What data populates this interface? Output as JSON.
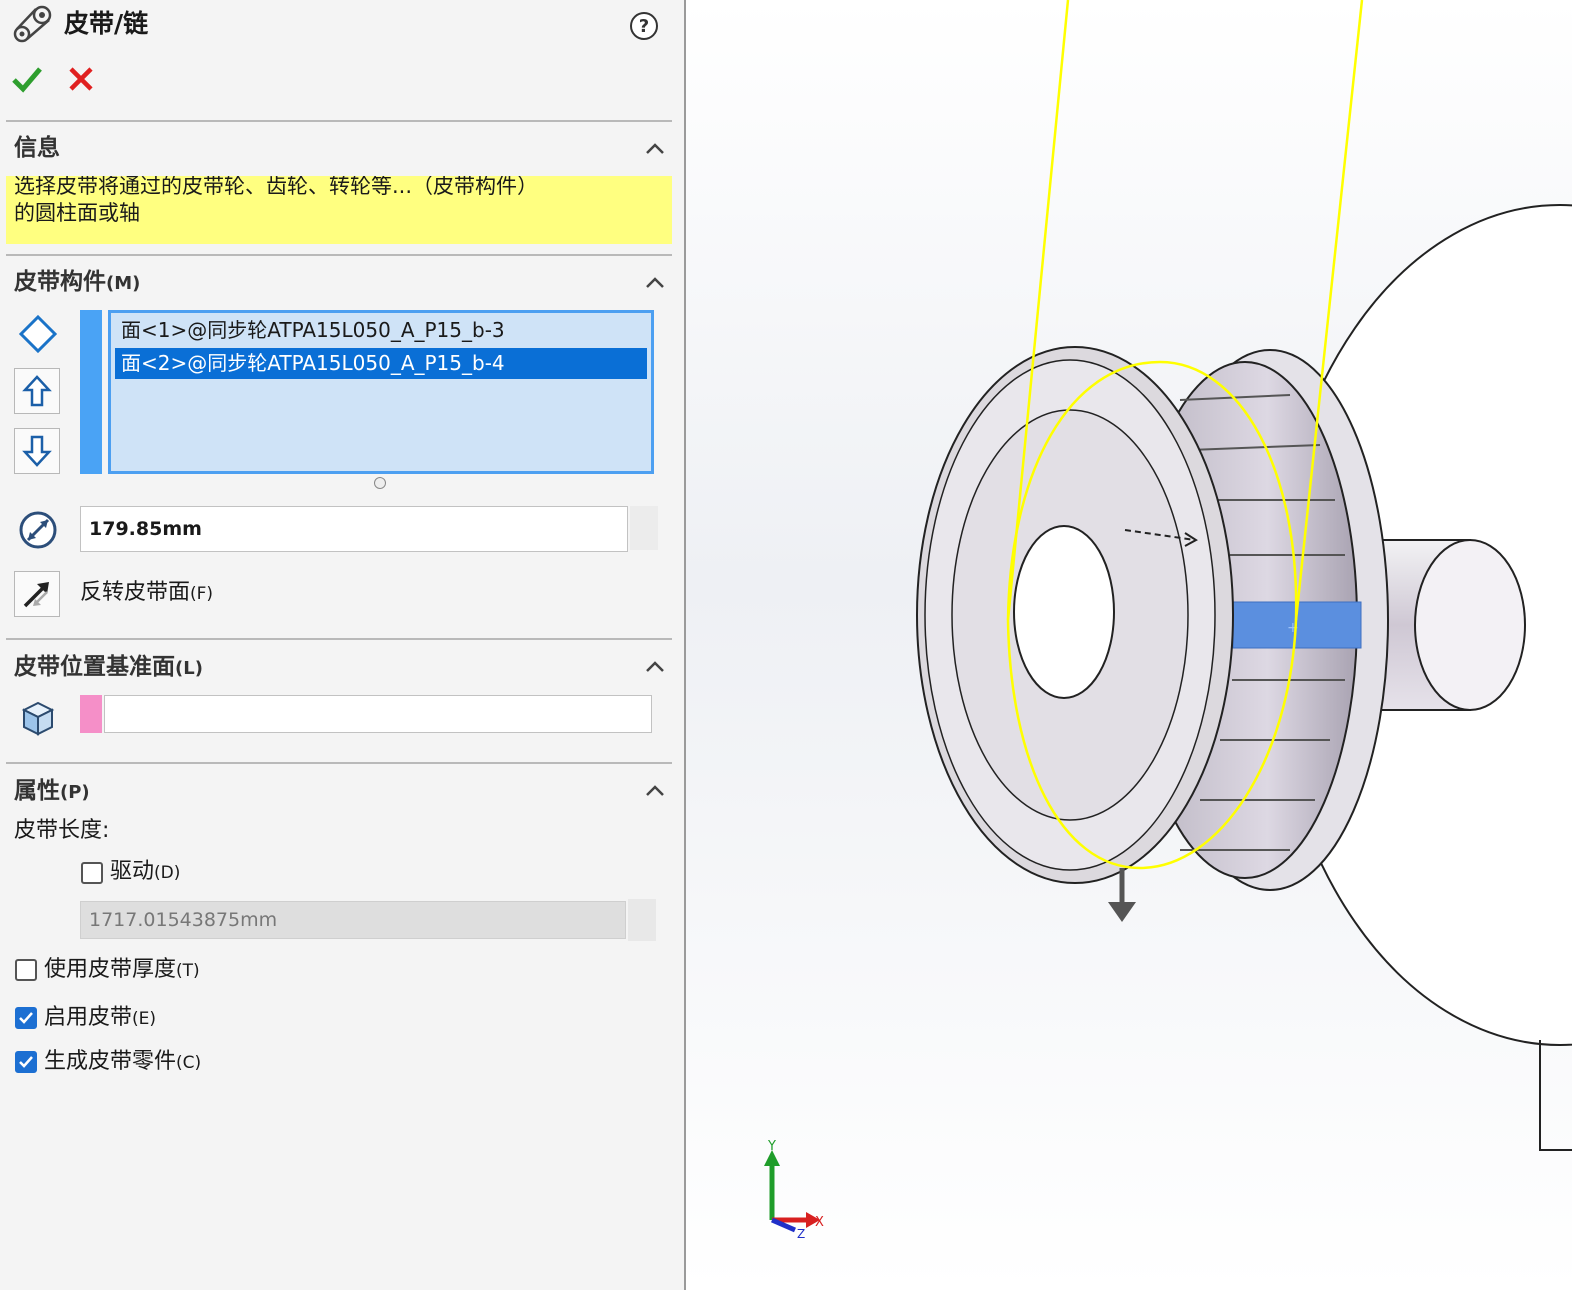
{
  "panel": {
    "title": "皮带/链",
    "help_icon": "question-icon",
    "ok_icon": "checkmark-icon",
    "cancel_icon": "x-icon"
  },
  "info_section": {
    "title": "信息",
    "message_line1": "选择皮带将通过的皮带轮、齿轮、转轮等...（皮带构件）",
    "message_line2": "的圆柱面或轴"
  },
  "members_section": {
    "title": "皮带构件",
    "shortcut": "(M)",
    "items": [
      {
        "label": "面<1>@同步轮ATPA15L050_A_P15_b-3",
        "selected": false
      },
      {
        "label": "面<2>@同步轮ATPA15L050_A_P15_b-4",
        "selected": true
      }
    ],
    "diameter_value": "179.85mm",
    "flip_label": "反转皮带面",
    "flip_shortcut": "(F)"
  },
  "position_section": {
    "title": "皮带位置基准面",
    "shortcut": "(L)",
    "plane_value": ""
  },
  "properties_section": {
    "title": "属性",
    "shortcut": "(P)",
    "length_label": "皮带长度:",
    "driving_label": "驱动",
    "driving_shortcut": "(D)",
    "driving_checked": false,
    "length_value": "1717.01543875mm",
    "thickness_label": "使用皮带厚度",
    "thickness_shortcut": "(T)",
    "thickness_checked": false,
    "enable_label": "启用皮带",
    "enable_shortcut": "(E)",
    "enable_checked": true,
    "create_part_label": "生成皮带零件",
    "create_part_shortcut": "(C)",
    "create_part_checked": true
  },
  "triad": {
    "x": "X",
    "y": "Y",
    "z": "Z"
  },
  "colors": {
    "accent": "#0a6fd6",
    "belt_path": "#ffff00",
    "info_bg": "#ffff80",
    "ok": "#2e9e2e",
    "cancel": "#e02020"
  }
}
